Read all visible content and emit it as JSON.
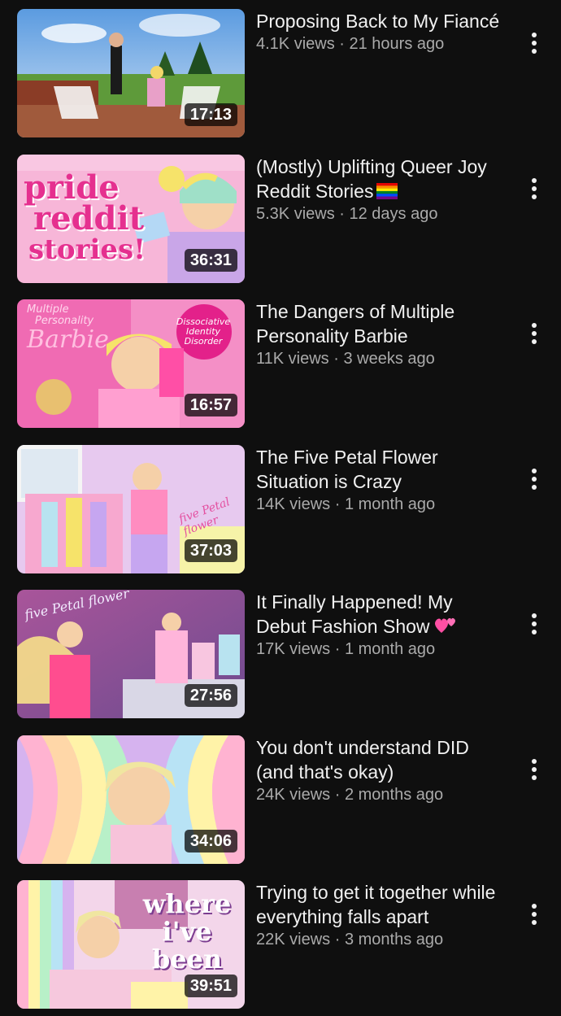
{
  "videos": [
    {
      "title": "Proposing Back to My Fiancé",
      "views": "4.1K views",
      "age": "21 hours ago",
      "duration": "17:13",
      "thumb_text": ""
    },
    {
      "title": "(Mostly) Uplifting Queer Joy Reddit Stories",
      "title_emoji": "rainbow-flag-icon",
      "views": "5.3K views",
      "age": "12 days ago",
      "duration": "36:31",
      "thumb_text": [
        "pride",
        "reddit",
        "stories!"
      ]
    },
    {
      "title": "The Dangers of Multiple Personality Barbie",
      "views": "11K views",
      "age": "3 weeks ago",
      "duration": "16:57",
      "thumb_text": [
        "Multiple",
        "Personality",
        "Barbie",
        "Dissociative",
        "Identity",
        "Disorder"
      ]
    },
    {
      "title": "The Five Petal Flower Situation is Crazy",
      "views": "14K views",
      "age": "1 month ago",
      "duration": "37:03",
      "thumb_text": [
        "five Petal flower"
      ]
    },
    {
      "title": "It Finally Happened! My Debut Fashion Show",
      "title_emoji": "two-hearts-icon",
      "views": "17K views",
      "age": "1 month ago",
      "duration": "27:56",
      "thumb_text": [
        "five Petal flower"
      ]
    },
    {
      "title": "You don't understand DID (and that's okay)",
      "views": "24K views",
      "age": "2 months ago",
      "duration": "34:06",
      "thumb_text": ""
    },
    {
      "title": "Trying to get it together while everything falls apart",
      "views": "22K views",
      "age": "3 months ago",
      "duration": "39:51",
      "thumb_text": [
        "where",
        "i've",
        "been"
      ]
    }
  ],
  "separator": " · ",
  "icons": {
    "more": "more-vert-icon"
  },
  "colors": {
    "background": "#0f0f0f",
    "title": "#f1f1f1",
    "meta": "#aaaaaa"
  }
}
